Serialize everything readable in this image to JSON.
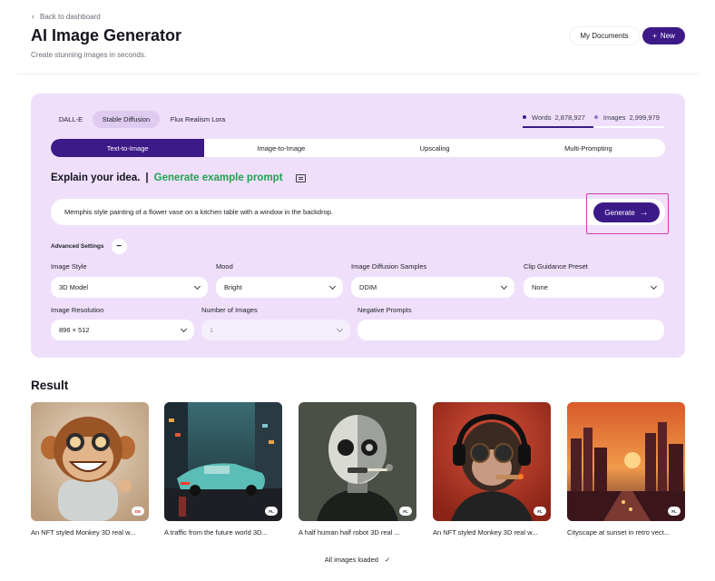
{
  "header": {
    "back_label": "Back to dashboard",
    "title": "AI Image Generator",
    "subtitle": "Create stunning images in seconds.",
    "my_documents_label": "My Documents",
    "new_label": "New"
  },
  "models": {
    "tabs": [
      "DALL-E",
      "Stable Diffusion",
      "Flux Realism Lora"
    ],
    "active": "Stable Diffusion"
  },
  "stats": {
    "words_label": "Words",
    "words_value": "2,878,927",
    "images_label": "Images",
    "images_value": "2,999,979",
    "usage_fraction": 0.5
  },
  "modes": {
    "tabs": [
      "Text-to-Image",
      "Image-to-Image",
      "Upscaling",
      "Multi-Prompting"
    ],
    "active": "Text-to-Image"
  },
  "prompt": {
    "heading": "Explain your idea.",
    "separator": "|",
    "example_link": "Generate example prompt",
    "value": "Memphis style painting of a flower vase on a kitchen table with a window in the backdrop.",
    "generate_label": "Generate"
  },
  "advanced": {
    "label": "Advanced Settings",
    "toggle_symbol": "−",
    "image_style_label": "Image Style",
    "image_style_value": "3D Model",
    "mood_label": "Mood",
    "mood_value": "Bright",
    "diffusion_label": "Image Diffusion Samples",
    "diffusion_value": "DDIM",
    "clip_label": "Clip Guidance Preset",
    "clip_value": "None",
    "resolution_label": "Image Resolution",
    "resolution_value": "896 × 512",
    "num_images_label": "Number of Images",
    "num_images_value": "1",
    "negative_label": "Negative Prompts",
    "negative_value": ""
  },
  "results": {
    "title": "Result",
    "items": [
      {
        "caption": "An NFT styled Monkey 3D real w...",
        "badge": "DE",
        "badge_color": "#d23a3a"
      },
      {
        "caption": "A traffic from the future world 3D...",
        "badge": "FL",
        "badge_color": "#22222c"
      },
      {
        "caption": "A half human half robot 3D real ...",
        "badge": "FL",
        "badge_color": "#22222c"
      },
      {
        "caption": "An NFT styled Monkey 3D real w...",
        "badge": "FL",
        "badge_color": "#22222c"
      },
      {
        "caption": "Cityscape at sunset in retro vect...",
        "badge": "FL",
        "badge_color": "#22222c"
      }
    ],
    "status": "All images loaded"
  },
  "colors": {
    "primary": "#3c1a88",
    "panel_bg": "#efdffb",
    "highlight": "#d33bb5",
    "example_link": "#1fa24d"
  }
}
